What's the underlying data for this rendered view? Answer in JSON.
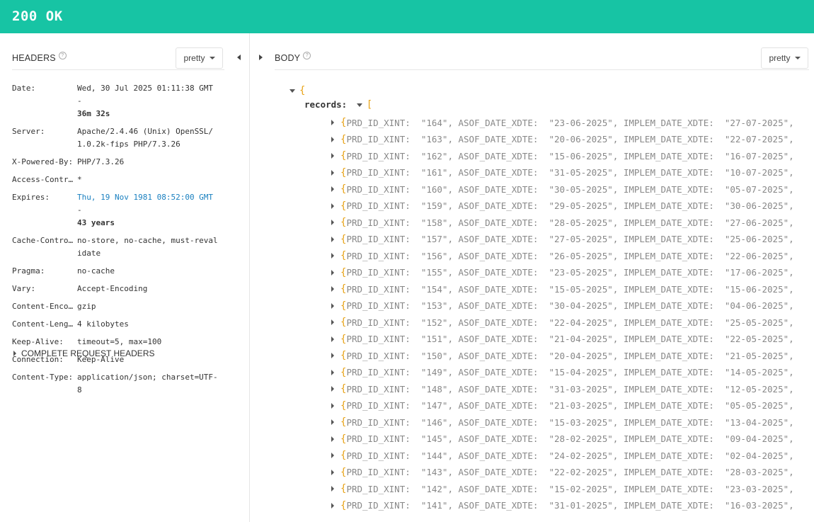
{
  "status": {
    "text": "200 OK"
  },
  "headers": {
    "title": "HEADERS",
    "help": "?",
    "pretty_label": "pretty",
    "rows": [
      {
        "name": "Date:",
        "value": "Wed, 30 Jul 2025 01:11:38 GMT -",
        "extra": "36m 32s"
      },
      {
        "name": "Server:",
        "value": "Apache/2.4.46 (Unix) OpenSSL/1.0.2k-fips PHP/7.3.26"
      },
      {
        "name": "X-Powered-By:",
        "value": "PHP/7.3.26"
      },
      {
        "name": "Access-Contr…",
        "value": "*"
      },
      {
        "name": "Expires:",
        "value": "Thu, 19 Nov 1981 08:52:00 GMT",
        "sep": " -",
        "extra": "43 years"
      },
      {
        "name": "Cache-Contro…",
        "value": "no-store, no-cache, must-revalidate"
      },
      {
        "name": "Pragma:",
        "value": "no-cache"
      },
      {
        "name": "Vary:",
        "value": "Accept-Encoding"
      },
      {
        "name": "Content-Enco…",
        "value": "gzip"
      },
      {
        "name": "Content-Leng…",
        "value": "4 kilobytes"
      },
      {
        "name": "Keep-Alive:",
        "value": "timeout=5, max=100"
      },
      {
        "name": "Connection:",
        "value": "Keep-Alive"
      },
      {
        "name": "Content-Type:",
        "value": "application/json; charset=UTF-8"
      }
    ],
    "complete_label": "COMPLETE REQUEST HEADERS"
  },
  "body": {
    "title": "BODY",
    "help": "?",
    "pretty_label": "pretty",
    "open_brace": "{",
    "records_key": "records:",
    "open_bracket": "[",
    "record_brace": "{",
    "records": [
      {
        "id": "\"164\",",
        "asof": "\"23-06-2025\",",
        "implem": "\"27-07-2025\","
      },
      {
        "id": "\"163\",",
        "asof": "\"20-06-2025\",",
        "implem": "\"22-07-2025\","
      },
      {
        "id": "\"162\",",
        "asof": "\"15-06-2025\",",
        "implem": "\"16-07-2025\","
      },
      {
        "id": "\"161\",",
        "asof": "\"31-05-2025\",",
        "implem": "\"10-07-2025\","
      },
      {
        "id": "\"160\",",
        "asof": "\"30-05-2025\",",
        "implem": "\"05-07-2025\","
      },
      {
        "id": "\"159\",",
        "asof": "\"29-05-2025\",",
        "implem": "\"30-06-2025\","
      },
      {
        "id": "\"158\",",
        "asof": "\"28-05-2025\",",
        "implem": "\"27-06-2025\","
      },
      {
        "id": "\"157\",",
        "asof": "\"27-05-2025\",",
        "implem": "\"25-06-2025\","
      },
      {
        "id": "\"156\",",
        "asof": "\"26-05-2025\",",
        "implem": "\"22-06-2025\","
      },
      {
        "id": "\"155\",",
        "asof": "\"23-05-2025\",",
        "implem": "\"17-06-2025\","
      },
      {
        "id": "\"154\",",
        "asof": "\"15-05-2025\",",
        "implem": "\"15-06-2025\","
      },
      {
        "id": "\"153\",",
        "asof": "\"30-04-2025\",",
        "implem": "\"04-06-2025\","
      },
      {
        "id": "\"152\",",
        "asof": "\"22-04-2025\",",
        "implem": "\"25-05-2025\","
      },
      {
        "id": "\"151\",",
        "asof": "\"21-04-2025\",",
        "implem": "\"22-05-2025\","
      },
      {
        "id": "\"150\",",
        "asof": "\"20-04-2025\",",
        "implem": "\"21-05-2025\","
      },
      {
        "id": "\"149\",",
        "asof": "\"15-04-2025\",",
        "implem": "\"14-05-2025\","
      },
      {
        "id": "\"148\",",
        "asof": "\"31-03-2025\",",
        "implem": "\"12-05-2025\","
      },
      {
        "id": "\"147\",",
        "asof": "\"21-03-2025\",",
        "implem": "\"05-05-2025\","
      },
      {
        "id": "\"146\",",
        "asof": "\"15-03-2025\",",
        "implem": "\"13-04-2025\","
      },
      {
        "id": "\"145\",",
        "asof": "\"28-02-2025\",",
        "implem": "\"09-04-2025\","
      },
      {
        "id": "\"144\",",
        "asof": "\"24-02-2025\",",
        "implem": "\"02-04-2025\","
      },
      {
        "id": "\"143\",",
        "asof": "\"22-02-2025\",",
        "implem": "\"28-03-2025\","
      },
      {
        "id": "\"142\",",
        "asof": "\"15-02-2025\",",
        "implem": "\"23-03-2025\","
      },
      {
        "id": "\"141\",",
        "asof": "\"31-01-2025\",",
        "implem": "\"16-03-2025\","
      }
    ],
    "field_names": {
      "id": "PRD_ID_XINT:",
      "asof": "ASOF_DATE_XDTE:",
      "implem": "IMPLEM_DATE_XDTE:"
    }
  },
  "colors": {
    "status_bar": "#17c4a4",
    "brace": "#e8a317",
    "link": "#1a80c0"
  }
}
